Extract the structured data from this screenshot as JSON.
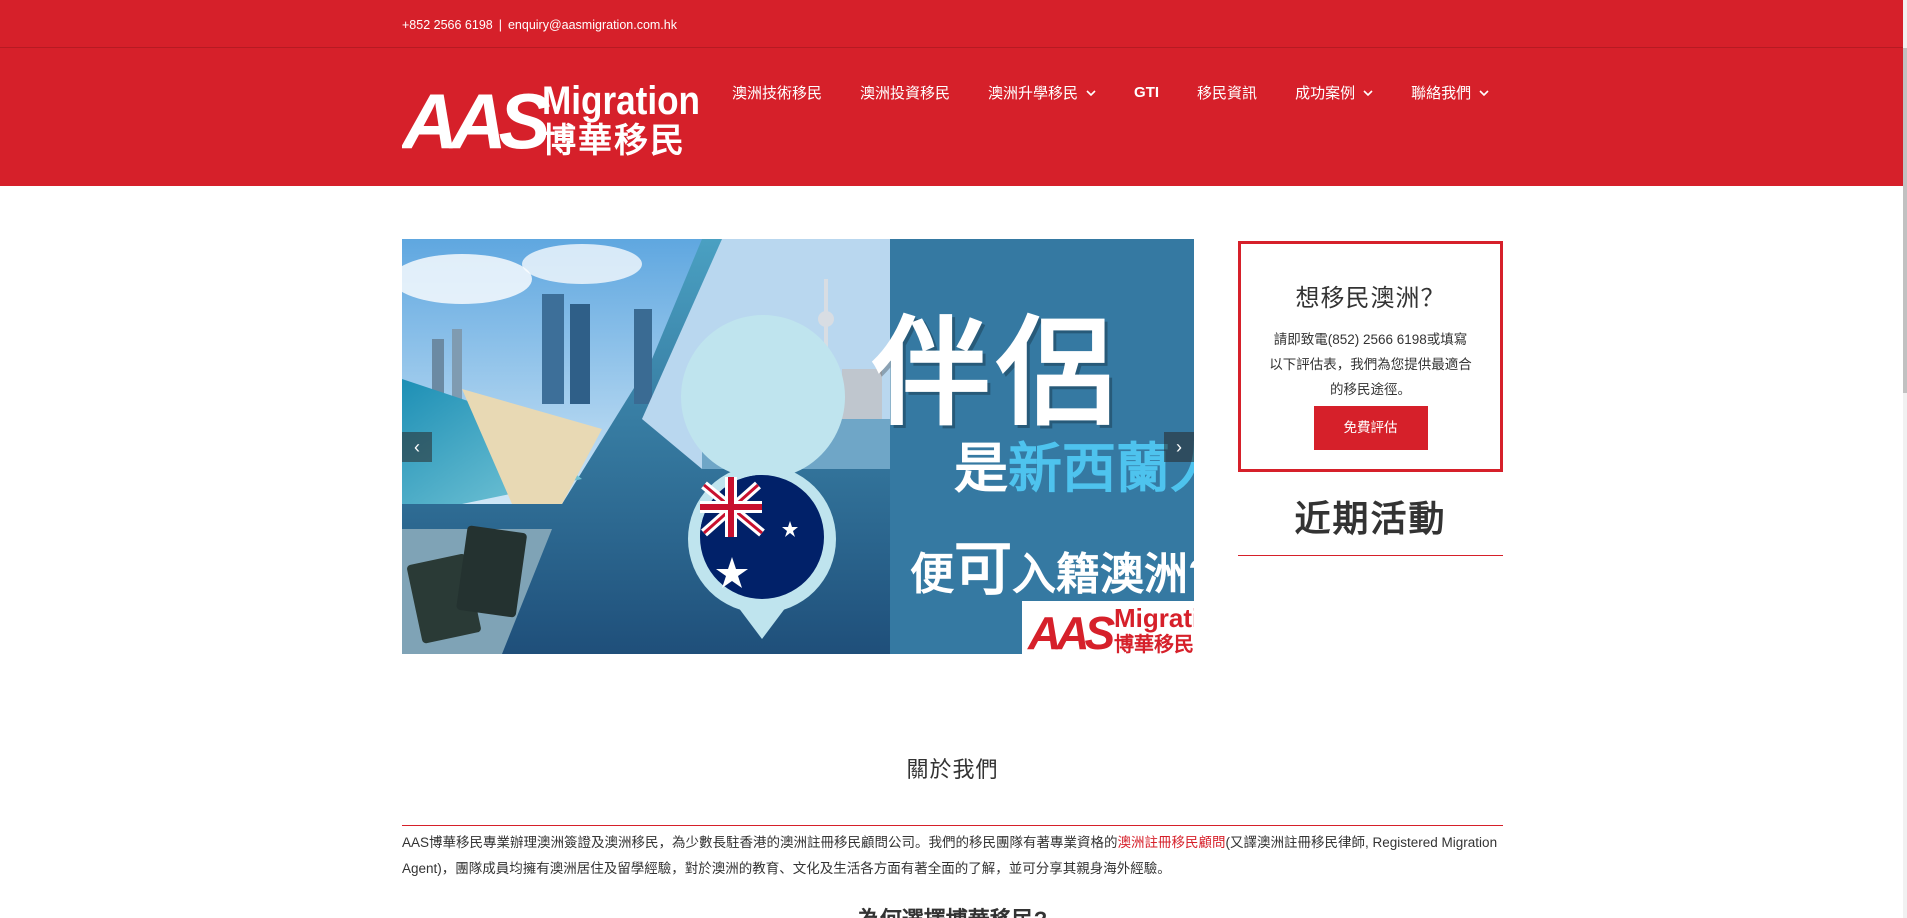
{
  "topbar": {
    "phone": "+852 2566 6198",
    "separator": "|",
    "email": "enquiry@aasmigration.com.hk"
  },
  "logo": {
    "brand_en": "Migration",
    "brand_letters": "AAS",
    "brand_zh": "博華移民"
  },
  "nav": {
    "items": [
      {
        "label": "澳洲技術移民",
        "has_dropdown": false
      },
      {
        "label": "澳洲投資移民",
        "has_dropdown": false
      },
      {
        "label": "澳洲升學移民",
        "has_dropdown": true
      },
      {
        "label": "GTI",
        "has_dropdown": false
      },
      {
        "label": "移民資訊",
        "has_dropdown": false
      },
      {
        "label": "成功案例",
        "has_dropdown": true
      },
      {
        "label": "聯絡我們",
        "has_dropdown": true
      }
    ]
  },
  "banner": {
    "line1": "伴侶",
    "line2_prefix": "是",
    "line2_highlight": "新西蘭人",
    "line3_prefix": "便",
    "line3_big": "可",
    "line3_suffix": "入籍澳洲?",
    "logo_en": "Migration",
    "logo_zh": "博華移民",
    "prev_icon": "‹",
    "next_icon": "›"
  },
  "sidebar": {
    "cta_title": "想移民澳洲？",
    "cta_text": "請即致電(852) 2566 6198或填寫以下評估表，我們為您提供最適合的移民途徑。",
    "cta_button": "免費評估",
    "events_title": "近期活動"
  },
  "about": {
    "title": "關於我們",
    "text_part1": "AAS博華移民專業辦理澳洲簽證及澳洲移民，為少數長駐香港的澳洲註冊移民顧問公司。我們的移民團隊有著專業資格的",
    "text_link": "澳洲註冊移民顧問",
    "text_part2": "(又譯澳洲註冊移民律師, Registered Migration Agent)，團隊成員均擁有澳洲居住及留學經驗，對於澳洲的教育、文化及生活各方面有著全面的了解，並可分享其親身海外經驗。",
    "why_title": "為何選擇博華移民?"
  },
  "colors": {
    "brand_red": "#d6202a",
    "highlight_blue": "#4ec3ee"
  }
}
